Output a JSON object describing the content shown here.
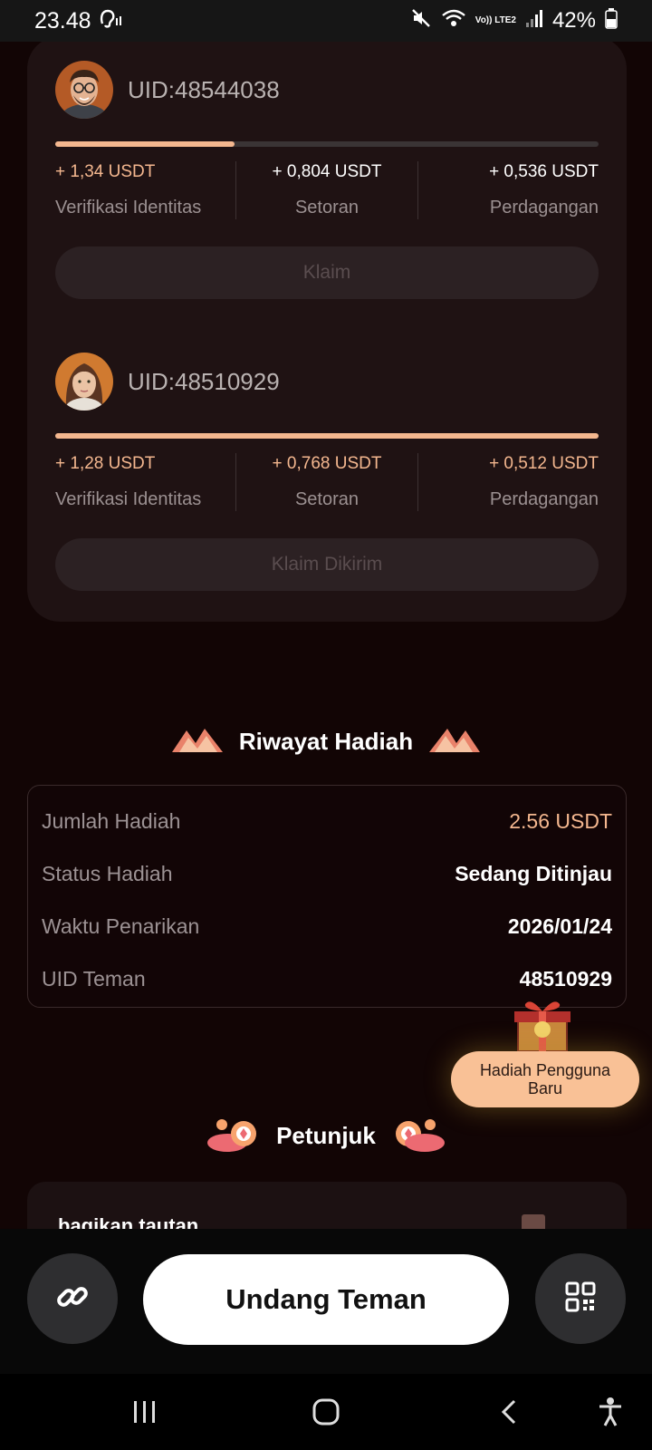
{
  "status_bar": {
    "time": "23.48",
    "network": "Vo)) LTE2",
    "battery": "42%"
  },
  "referrals": [
    {
      "uid": "UID:48544038",
      "progress_fraction": 0.33,
      "identity_amount": "+ 1,34 USDT",
      "identity_label": "Verifikasi Identitas",
      "deposit_amount": "+ 0,804 USDT",
      "deposit_label": "Setoran",
      "trade_amount": "+ 0,536 USDT",
      "trade_label": "Perdagangan",
      "button_label": "Klaim"
    },
    {
      "uid": "UID:48510929",
      "progress_fraction": 1.0,
      "identity_amount": "+ 1,28 USDT",
      "identity_label": "Verifikasi Identitas",
      "deposit_amount": "+ 0,768 USDT",
      "deposit_label": "Setoran",
      "trade_amount": "+ 0,512 USDT",
      "trade_label": "Perdagangan",
      "button_label": "Klaim Dikirim"
    }
  ],
  "history": {
    "title": "Riwayat Hadiah",
    "rows": [
      {
        "label": "Jumlah Hadiah",
        "value": "2.56 USDT"
      },
      {
        "label": "Status Hadiah",
        "value": "Sedang Ditinjau"
      },
      {
        "label": "Waktu Penarikan",
        "value": "2026/01/24"
      },
      {
        "label": "UID Teman",
        "value": "48510929"
      }
    ]
  },
  "new_user_gift": {
    "label": "Hadiah Pengguna Baru"
  },
  "guide": {
    "title": "Petunjuk",
    "first_step": "bagikan tautan"
  },
  "actions": {
    "invite_label": "Undang Teman",
    "link_icon": "link-icon",
    "qr_icon": "qr-code-icon"
  },
  "colors": {
    "accent": "#f4b78f",
    "background": "#120505",
    "card": "#1f1213"
  }
}
